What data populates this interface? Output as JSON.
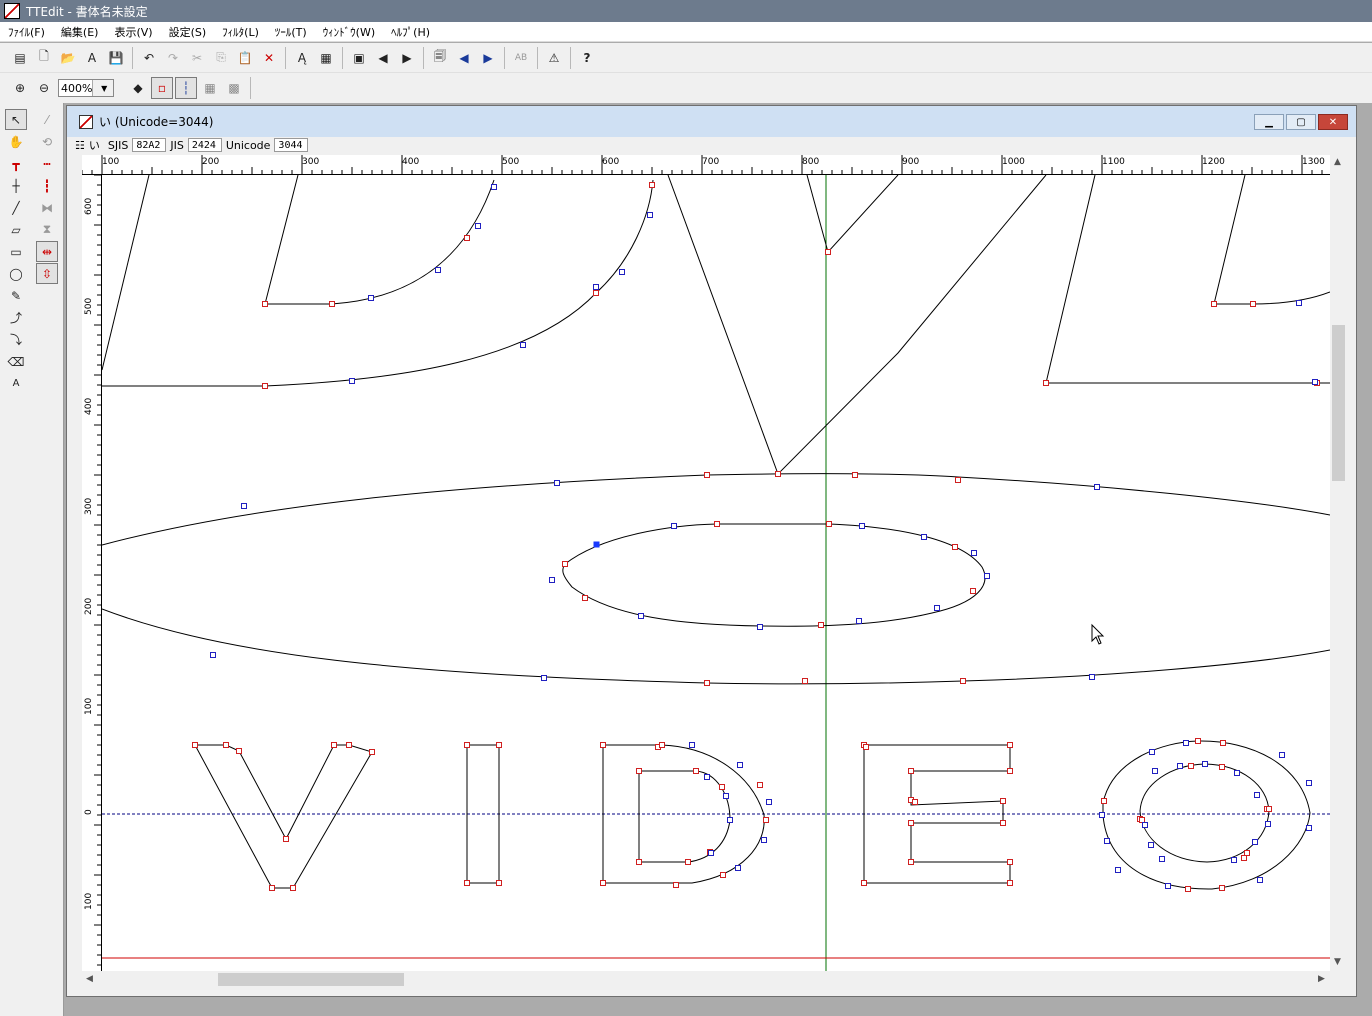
{
  "app": {
    "title": "TTEdit - 書体名未設定",
    "colors": {
      "titlebar": "#6d7b8d",
      "contour": "#000000",
      "point_on": "#d02020",
      "point_off": "#2020c0",
      "baseline": "#000080",
      "guide_green": "#007000",
      "guide_red": "#d00000"
    }
  },
  "menu": [
    "ﾌｧｲﾙ(F)",
    "編集(E)",
    "表示(V)",
    "設定(S)",
    "ﾌｨﾙﾀ(L)",
    "ﾂｰﾙ(T)",
    "ｳｨﾝﾄﾞｳ(W)",
    "ﾍﾙﾌﾟ(H)"
  ],
  "toolbar": {
    "zoom_value": "400%",
    "ab_label": "AB",
    "help_label": "?"
  },
  "document": {
    "title": "い (Unicode=3044)",
    "char": "い",
    "sjis_label": "SJIS",
    "sjis_value": "82A2",
    "jis_label": "JIS",
    "jis_value": "2424",
    "unicode_label": "Unicode",
    "unicode_value": "3044"
  },
  "ruler": {
    "h_ticks": [
      "100",
      "200",
      "300",
      "400",
      "500",
      "600",
      "700",
      "800",
      "900",
      "1000",
      "1100",
      "1200",
      "1300"
    ],
    "v_ticks": [
      "600",
      "500",
      "400",
      "300",
      "200",
      "100",
      "0",
      "100"
    ]
  }
}
